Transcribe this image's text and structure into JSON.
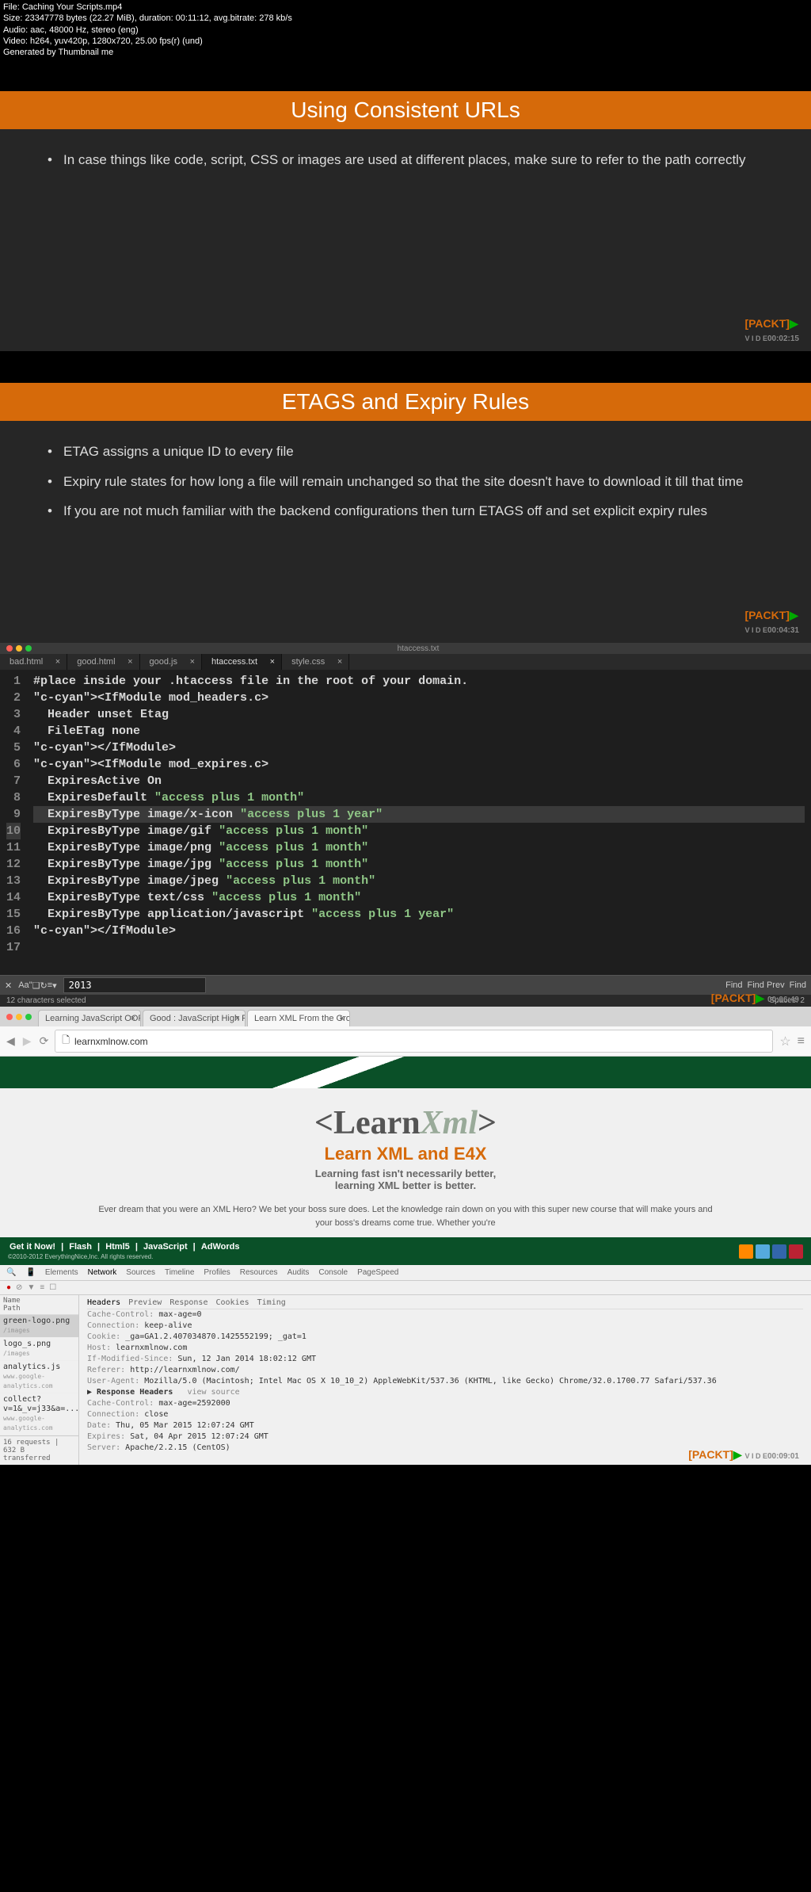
{
  "meta": {
    "file": "File: Caching Your Scripts.mp4",
    "size": "Size: 23347778 bytes (22.27 MiB), duration: 00:11:12, avg.bitrate: 278 kb/s",
    "audio": "Audio: aac, 48000 Hz, stereo (eng)",
    "video": "Video: h264, yuv420p, 1280x720, 25.00 fps(r) (und)",
    "gen": "Generated by Thumbnail me"
  },
  "slide1": {
    "title": "Using Consistent URLs",
    "bullet1": "In case things like code, script, CSS or images are used at different places, make sure to refer to the path correctly",
    "watermark": "[PACKT]",
    "ts": "00:02:15"
  },
  "slide2": {
    "title": "ETAGS and Expiry Rules",
    "bullet1": "ETAG assigns a unique ID to every file",
    "bullet2": "Expiry rule states for how long a file will remain unchanged so that the site doesn't have to download it till that time",
    "bullet3": "If you are not much familiar with the backend configurations then turn ETAGS off and set explicit expiry rules",
    "watermark": "[PACKT]",
    "ts": "00:04:31"
  },
  "code": {
    "titlebar": "htaccess.txt",
    "tabs": [
      "bad.html",
      "good.html",
      "good.js",
      "htaccess.txt",
      "style.css"
    ],
    "activeTab": 3,
    "lines": [
      "#place inside your .htaccess file in the root of your domain.",
      "<IfModule mod_headers.c>",
      "  Header unset Etag",
      "  FileETag none",
      "</IfModule>",
      "",
      "<IfModule mod_expires.c>",
      "  ExpiresActive On",
      "  ExpiresDefault \"access plus 1 month\"",
      "  ExpiresByType image/x-icon \"access plus 1 year\"",
      "  ExpiresByType image/gif \"access plus 1 month\"",
      "  ExpiresByType image/png \"access plus 1 month\"",
      "  ExpiresByType image/jpg \"access plus 1 month\"",
      "  ExpiresByType image/jpeg \"access plus 1 month\"",
      "  ExpiresByType text/css \"access plus 1 month\"",
      "  ExpiresByType application/javascript \"access plus 1 year\"",
      "</IfModule>"
    ],
    "find_value": "2013",
    "find_label": "Find",
    "find_prev": "Find Prev",
    "find_next": "Find",
    "status_left": "12 characters selected",
    "status_right": "Spaces: 2",
    "ts": "00:06:49"
  },
  "browser": {
    "tabs": [
      "Learning JavaScript OOP",
      "Good : JavaScript High Pe",
      "Learn XML From the Grou"
    ],
    "activeTab": 2,
    "url": "learnxmlnow.com",
    "logo_pre": "<Learn",
    "logo_xml": "Xml",
    "logo_post": ">",
    "subtitle": "Learn XML and E4X",
    "tagline1": "Learning fast isn't necessarily better,",
    "tagline2": "learning XML better is better.",
    "desc": "Ever dream that you were an XML Hero? We bet your boss sure does. Let the knowledge rain down on you with this super new course that will make yours and your boss's dreams come true. Whether you're",
    "nav_links": [
      "Get it Now!",
      "Flash",
      "Html5",
      "JavaScript",
      "AdWords"
    ],
    "copyright": "©2010-2012 EverythingNice,Inc. All rights reserved."
  },
  "devtools": {
    "main_tabs": [
      "Elements",
      "Network",
      "Sources",
      "Timeline",
      "Profiles",
      "Resources",
      "Audits",
      "Console",
      "PageSpeed"
    ],
    "activeMainTab": 1,
    "list_header": "Name\nPath",
    "requests": [
      {
        "name": "green-logo.png",
        "path": "/images",
        "selected": true
      },
      {
        "name": "logo_s.png",
        "path": "/images"
      },
      {
        "name": "analytics.js",
        "path": "www.google-analytics.com"
      },
      {
        "name": "collect?v=1&_v=j33&a=...",
        "path": "www.google-analytics.com"
      }
    ],
    "list_footer": "16 requests | 632 B transferred",
    "header_tabs": [
      "Headers",
      "Preview",
      "Response",
      "Cookies",
      "Timing"
    ],
    "headers": [
      {
        "k": "Cache-Control:",
        "v": "max-age=0"
      },
      {
        "k": "Connection:",
        "v": "keep-alive"
      },
      {
        "k": "Cookie:",
        "v": "_ga=GA1.2.407034870.1425552199; _gat=1"
      },
      {
        "k": "Host:",
        "v": "learnxmlnow.com"
      },
      {
        "k": "If-Modified-Since:",
        "v": "Sun, 12 Jan 2014 18:02:12 GMT"
      },
      {
        "k": "Referer:",
        "v": "http://learnxmlnow.com/"
      },
      {
        "k": "User-Agent:",
        "v": "Mozilla/5.0 (Macintosh; Intel Mac OS X 10_10_2) AppleWebKit/537.36 (KHTML, like Gecko) Chrome/32.0.1700.77 Safari/537.36"
      }
    ],
    "resp_header_label": "▶ Response Headers",
    "view_source": "view source",
    "resp_headers": [
      {
        "k": "Cache-Control:",
        "v": "max-age=2592000"
      },
      {
        "k": "Connection:",
        "v": "close"
      },
      {
        "k": "Date:",
        "v": "Thu, 05 Mar 2015 12:07:24 GMT"
      },
      {
        "k": "Expires:",
        "v": "Sat, 04 Apr 2015 12:07:24 GMT"
      },
      {
        "k": "Server:",
        "v": "Apache/2.2.15 (CentOS)"
      }
    ],
    "watermark": "[PACKT]",
    "ts": "00:09:01"
  }
}
